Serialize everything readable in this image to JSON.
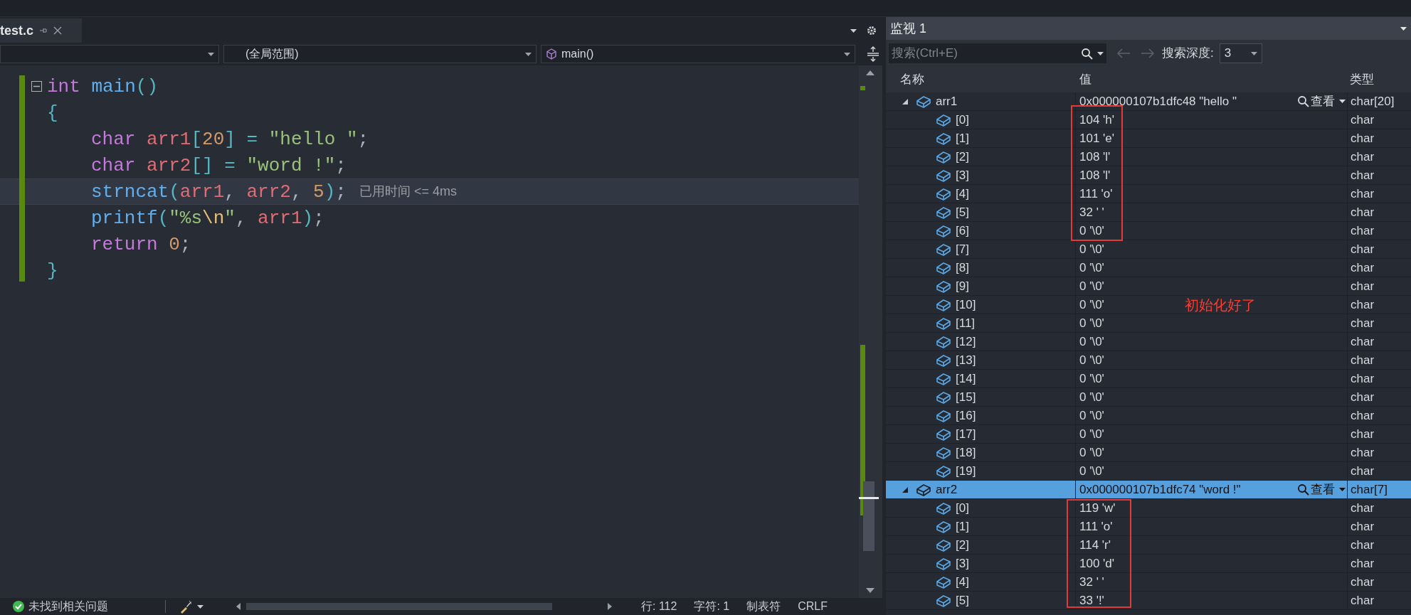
{
  "editor_tab": {
    "title": "test.c",
    "selected": true
  },
  "nav_bar": {
    "scope": "(全局范围)",
    "member": "main()"
  },
  "code_lines": [
    {
      "collapsible": true,
      "current": false,
      "indented": false,
      "tokens": [
        {
          "kind": "keyword",
          "text": "int"
        },
        {
          "kind": "function",
          "text": " main"
        },
        {
          "kind": "bracket",
          "text": "()"
        }
      ]
    },
    {
      "collapsible": false,
      "current": false,
      "indented": false,
      "tokens": [
        {
          "kind": "bracket",
          "text": "{"
        }
      ]
    },
    {
      "collapsible": false,
      "current": false,
      "indented": true,
      "tokens": [
        {
          "kind": "keyword",
          "text": "char"
        },
        {
          "kind": "variable",
          "text": " arr1"
        },
        {
          "kind": "bracket",
          "text": "["
        },
        {
          "kind": "number",
          "text": "20"
        },
        {
          "kind": "bracket",
          "text": "]"
        },
        {
          "kind": "operator",
          "text": " = "
        },
        {
          "kind": "string",
          "text": "\"hello \""
        },
        {
          "kind": "plain",
          "text": ";"
        }
      ]
    },
    {
      "collapsible": false,
      "current": false,
      "indented": true,
      "tokens": [
        {
          "kind": "keyword",
          "text": "char"
        },
        {
          "kind": "variable",
          "text": " arr2"
        },
        {
          "kind": "bracket",
          "text": "[]"
        },
        {
          "kind": "operator",
          "text": " = "
        },
        {
          "kind": "string",
          "text": "\"word !\""
        },
        {
          "kind": "plain",
          "text": ";"
        }
      ]
    },
    {
      "collapsible": false,
      "current": true,
      "indented": true,
      "hint": "已用时间 <= 4ms",
      "tokens": [
        {
          "kind": "function",
          "text": "strncat"
        },
        {
          "kind": "bracket",
          "text": "("
        },
        {
          "kind": "variable",
          "text": "arr1"
        },
        {
          "kind": "plain",
          "text": ", "
        },
        {
          "kind": "variable",
          "text": "arr2"
        },
        {
          "kind": "plain",
          "text": ", "
        },
        {
          "kind": "number",
          "text": "5"
        },
        {
          "kind": "bracket",
          "text": ")"
        },
        {
          "kind": "plain",
          "text": ";"
        }
      ]
    },
    {
      "collapsible": false,
      "current": false,
      "indented": true,
      "tokens": [
        {
          "kind": "function",
          "text": "printf"
        },
        {
          "kind": "bracket",
          "text": "("
        },
        {
          "kind": "string",
          "text": "\"%s"
        },
        {
          "kind": "escape",
          "text": "\\n"
        },
        {
          "kind": "string",
          "text": "\""
        },
        {
          "kind": "plain",
          "text": ", "
        },
        {
          "kind": "variable",
          "text": "arr1"
        },
        {
          "kind": "bracket",
          "text": ")"
        },
        {
          "kind": "plain",
          "text": ";"
        }
      ]
    },
    {
      "collapsible": false,
      "current": false,
      "indented": true,
      "tokens": [
        {
          "kind": "keyword",
          "text": "return"
        },
        {
          "kind": "number",
          "text": " 0"
        },
        {
          "kind": "plain",
          "text": ";"
        }
      ]
    },
    {
      "collapsible": false,
      "current": false,
      "indented": false,
      "tokens": [
        {
          "kind": "bracket",
          "text": "}"
        }
      ]
    }
  ],
  "status_bar": {
    "issues": "未找到相关问题",
    "line": "行: 112",
    "column": "字符: 1",
    "indent": "制表符",
    "line_ending": "CRLF"
  },
  "watch": {
    "title": "监视 1",
    "search": {
      "placeholder": "搜索(Ctrl+E)"
    },
    "depth_label": "搜索深度:",
    "depth": "3",
    "columns": [
      "名称",
      "值",
      "类型"
    ],
    "rows": [
      {
        "name": "arr1",
        "value": "0x000000107b1dfc48 \"hello \"",
        "view": "查看",
        "type": "char[20]",
        "expanded": true,
        "selected": false,
        "children": [
          {
            "name": "[0]",
            "value": "104 'h'",
            "type": "char",
            "selected": false
          },
          {
            "name": "[1]",
            "value": "101 'e'",
            "type": "char",
            "selected": false
          },
          {
            "name": "[2]",
            "value": "108 'l'",
            "type": "char",
            "selected": false
          },
          {
            "name": "[3]",
            "value": "108 'l'",
            "type": "char",
            "selected": false
          },
          {
            "name": "[4]",
            "value": "111 'o'",
            "type": "char",
            "selected": false
          },
          {
            "name": "[5]",
            "value": "32 ' '",
            "type": "char",
            "selected": false
          },
          {
            "name": "[6]",
            "value": "0 '\\0'",
            "type": "char",
            "selected": false
          },
          {
            "name": "[7]",
            "value": "0 '\\0'",
            "type": "char",
            "selected": false
          },
          {
            "name": "[8]",
            "value": "0 '\\0'",
            "type": "char",
            "selected": false
          },
          {
            "name": "[9]",
            "value": "0 '\\0'",
            "type": "char",
            "selected": false
          },
          {
            "name": "[10]",
            "value": "0 '\\0'",
            "note": "初始化好了",
            "type": "char",
            "selected": false
          },
          {
            "name": "[11]",
            "value": "0 '\\0'",
            "type": "char",
            "selected": false
          },
          {
            "name": "[12]",
            "value": "0 '\\0'",
            "type": "char",
            "selected": false
          },
          {
            "name": "[13]",
            "value": "0 '\\0'",
            "type": "char",
            "selected": false
          },
          {
            "name": "[14]",
            "value": "0 '\\0'",
            "type": "char",
            "selected": false
          },
          {
            "name": "[15]",
            "value": "0 '\\0'",
            "type": "char",
            "selected": false
          },
          {
            "name": "[16]",
            "value": "0 '\\0'",
            "type": "char",
            "selected": false
          },
          {
            "name": "[17]",
            "value": "0 '\\0'",
            "type": "char",
            "selected": false
          },
          {
            "name": "[18]",
            "value": "0 '\\0'",
            "type": "char",
            "selected": false
          },
          {
            "name": "[19]",
            "value": "0 '\\0'",
            "type": "char",
            "selected": false
          }
        ]
      },
      {
        "name": "arr2",
        "value": "0x000000107b1dfc74 \"word !\"",
        "view": "查看",
        "type": "char[7]",
        "expanded": true,
        "selected": true,
        "children": [
          {
            "name": "[0]",
            "value": "119 'w'",
            "type": "char",
            "selected": false
          },
          {
            "name": "[1]",
            "value": "111 'o'",
            "type": "char",
            "selected": false
          },
          {
            "name": "[2]",
            "value": "114 'r'",
            "type": "char",
            "selected": false
          },
          {
            "name": "[3]",
            "value": "100 'd'",
            "type": "char",
            "selected": false
          },
          {
            "name": "[4]",
            "value": "32 ' '",
            "type": "char",
            "selected": false
          },
          {
            "name": "[5]",
            "value": "33 '!'",
            "type": "char",
            "selected": false
          }
        ]
      }
    ]
  }
}
